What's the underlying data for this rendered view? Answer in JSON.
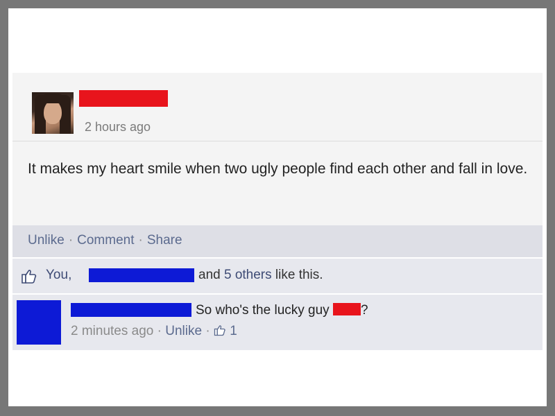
{
  "post": {
    "time": "2 hours ago",
    "text": "It makes my heart smile when two ugly people find each other and fall in love."
  },
  "actions": {
    "unlike": "Unlike",
    "comment": "Comment",
    "share": "Share",
    "separator": "·"
  },
  "likes": {
    "you": "You,",
    "rest_prefix": "and",
    "others": "5 others",
    "rest_suffix": "like this."
  },
  "comment": {
    "text_before": "So who's the lucky guy",
    "text_after": "?",
    "time": "2 minutes ago",
    "unlike": "Unlike",
    "like_count": "1"
  },
  "icons": {
    "like": "thumbs-up-icon"
  },
  "colors": {
    "redaction_red": "#e8141c",
    "redaction_blue": "#0d1ad6",
    "link": "#3e4b75"
  }
}
